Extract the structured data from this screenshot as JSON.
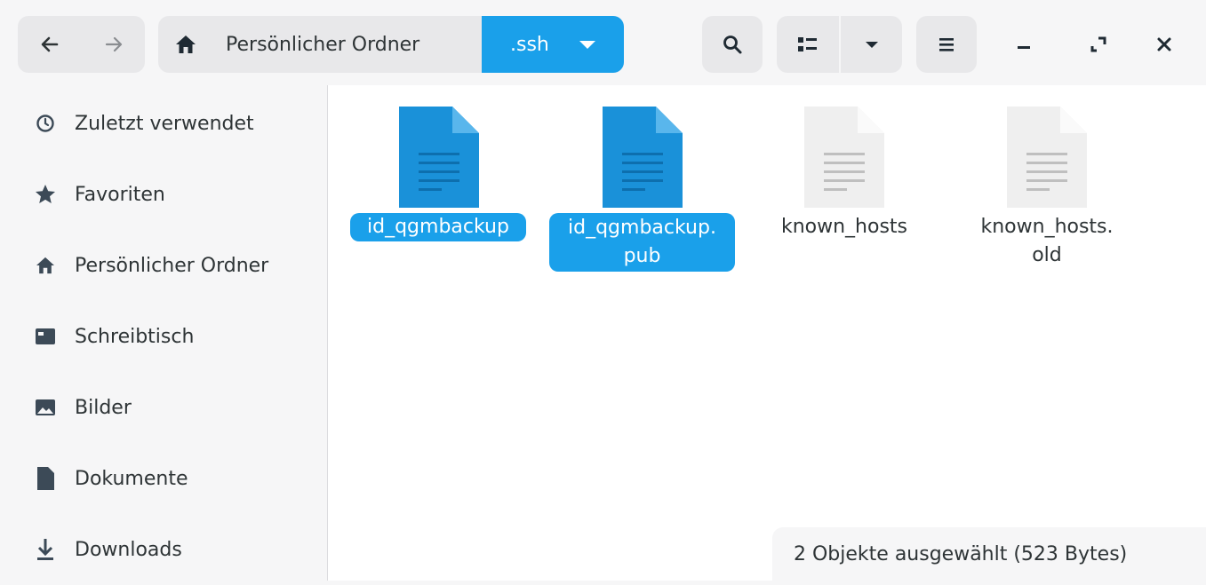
{
  "header": {
    "path": [
      {
        "label": "Persönlicher Ordner"
      },
      {
        "label": ".ssh"
      }
    ]
  },
  "sidebar": {
    "items": [
      {
        "label": "Zuletzt verwendet",
        "icon": "clock-icon"
      },
      {
        "label": "Favoriten",
        "icon": "star-icon"
      },
      {
        "label": "Persönlicher Ordner",
        "icon": "home-icon"
      },
      {
        "label": "Schreibtisch",
        "icon": "desktop-icon"
      },
      {
        "label": "Bilder",
        "icon": "pictures-icon"
      },
      {
        "label": "Dokumente",
        "icon": "document-icon"
      },
      {
        "label": "Downloads",
        "icon": "download-icon"
      }
    ]
  },
  "files": [
    {
      "name": "id_qgmbackup",
      "name_lines": [
        "id_qgmbackup"
      ],
      "selected": true
    },
    {
      "name": "id_qgmbackup.pub",
      "name_lines": [
        "id_qgmbackup.",
        "pub"
      ],
      "selected": true
    },
    {
      "name": "known_hosts",
      "name_lines": [
        "known_hosts"
      ],
      "selected": false
    },
    {
      "name": "known_hosts.old",
      "name_lines": [
        "known_hosts.",
        "old"
      ],
      "selected": false
    }
  ],
  "status": {
    "text": "2 Objekte ausgewählt (523 Bytes)"
  },
  "colors": {
    "accent": "#1aa0ea",
    "selected_doc": "#1a91d9",
    "plain_doc": "#efefef"
  }
}
